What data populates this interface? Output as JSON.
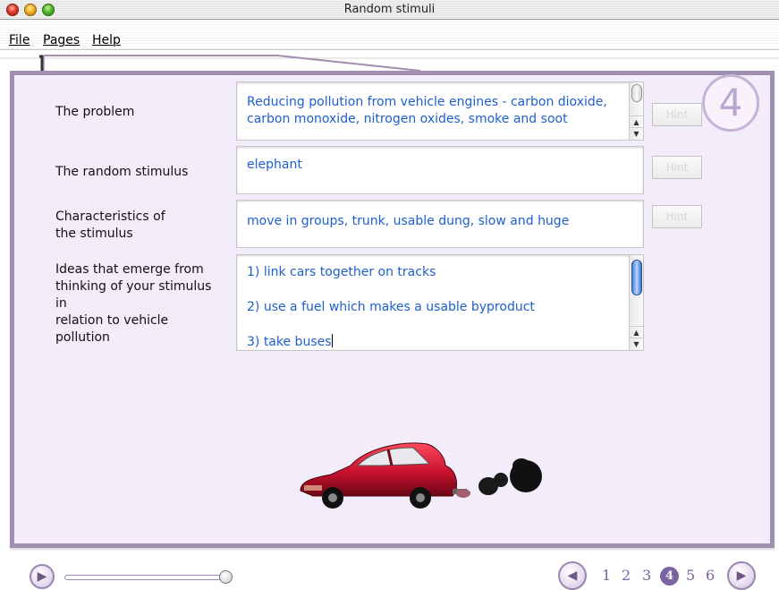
{
  "window": {
    "title": "Random stimuli"
  },
  "menu": {
    "file": "File",
    "pages": "Pages",
    "help": "Help"
  },
  "page_badge": "4",
  "rows": {
    "problem": {
      "label": "The problem",
      "value": "Reducing pollution from vehicle engines - carbon dioxide, carbon monoxide, nitrogen oxides, smoke and soot",
      "hint": "Hint"
    },
    "stimulus": {
      "label": "The random stimulus",
      "value": "elephant",
      "hint": "Hint"
    },
    "characteristics": {
      "label_line1": "Characteristics of",
      "label_line2": "the stimulus",
      "value": "move in groups, trunk, usable dung, slow and huge",
      "hint": "Hint"
    },
    "ideas": {
      "label_line1": "Ideas that emerge from",
      "label_line2": "thinking of your stimulus",
      "label_line3": "in",
      "label_line4": "relation to vehicle",
      "label_line5": "pollution",
      "items": [
        "1) link cars together on tracks",
        "2) use a fuel which makes a usable byproduct",
        "3) take buses"
      ]
    }
  },
  "pagination": {
    "pages": [
      "1",
      "2",
      "3",
      "4",
      "5",
      "6"
    ],
    "current": "4"
  },
  "slider": {
    "position": 1.0
  },
  "colors": {
    "panel_border": "#a28eb0",
    "panel_bg": "#f3ecfa",
    "field_text": "#1e5fcc",
    "accent": "#7b62a0"
  },
  "icons": {
    "play": "play-icon",
    "prev": "arrow-left-icon",
    "next": "arrow-right-icon"
  }
}
